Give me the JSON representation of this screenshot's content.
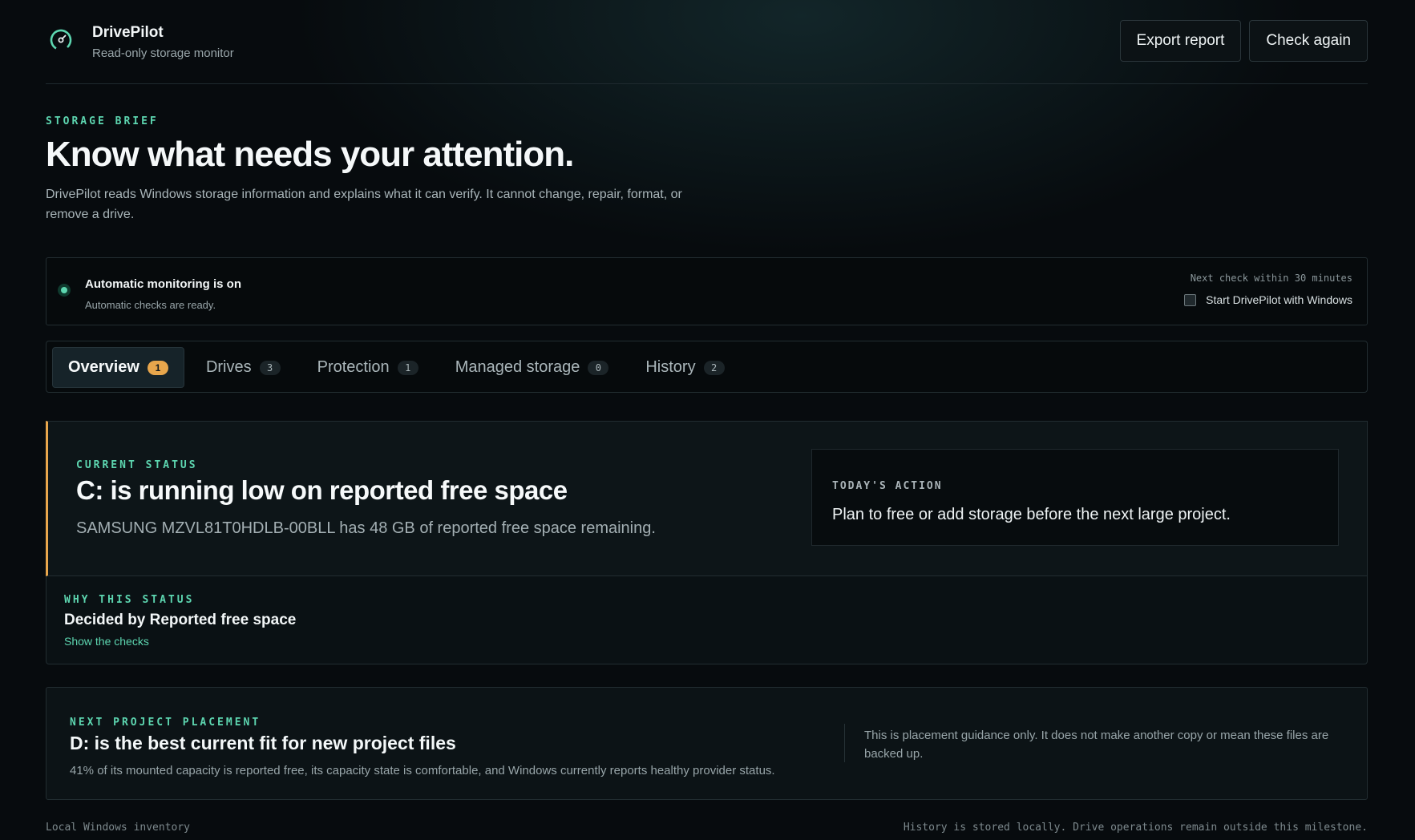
{
  "app": {
    "name": "DrivePilot",
    "subtitle": "Read-only storage monitor",
    "logo_icon": "gauge-icon",
    "accent_color": "#5dd6b0",
    "warn_color": "#e8a64c"
  },
  "header": {
    "export_label": "Export report",
    "check_label": "Check again"
  },
  "hero": {
    "eyebrow": "STORAGE BRIEF",
    "title": "Know what needs your attention.",
    "description": "DrivePilot reads Windows storage information and explains what it can verify. It cannot change, repair, format, or remove a drive."
  },
  "monitoring": {
    "status_icon": "status-dot-icon",
    "title": "Automatic monitoring is on",
    "subtitle": "Automatic checks are ready.",
    "next_check": "Next check within 30 minutes",
    "startup_label": "Start DrivePilot with Windows",
    "startup_checked": false
  },
  "tabs": [
    {
      "label": "Overview",
      "count": "1",
      "active": true
    },
    {
      "label": "Drives",
      "count": "3",
      "active": false
    },
    {
      "label": "Protection",
      "count": "1",
      "active": false
    },
    {
      "label": "Managed storage",
      "count": "0",
      "active": false
    },
    {
      "label": "History",
      "count": "2",
      "active": false
    }
  ],
  "status": {
    "eyebrow": "CURRENT STATUS",
    "title": "C: is running low on reported free space",
    "description": "SAMSUNG MZVL81T0HDLB-00BLL has 48 GB of reported free space remaining.",
    "action_eyebrow": "TODAY'S ACTION",
    "action_text": "Plan to free or add storage before the next large project."
  },
  "why": {
    "eyebrow": "WHY THIS STATUS",
    "title": "Decided by Reported free space",
    "link": "Show the checks"
  },
  "placement": {
    "eyebrow": "NEXT PROJECT PLACEMENT",
    "title": "D: is the best current fit for new project files",
    "description": "41% of its mounted capacity is reported free, its capacity state is comfortable, and Windows currently reports healthy provider status.",
    "note": "This is placement guidance only. It does not make another copy or mean these files are backed up."
  },
  "footer": {
    "left": "Local Windows inventory",
    "right": "History is stored locally. Drive operations remain outside this milestone."
  }
}
